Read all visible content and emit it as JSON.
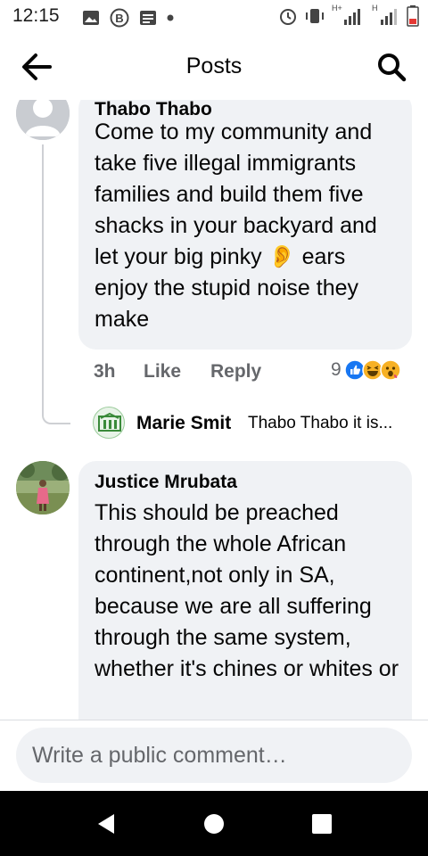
{
  "status_bar": {
    "time": "12:15",
    "icons_left": [
      "gallery-icon",
      "b-badge-icon",
      "news-icon",
      "dot-icon"
    ],
    "icons_right": [
      "alarm-icon",
      "vibrate-icon",
      "signal-h-plus-icon",
      "signal-h-icon",
      "battery-low-icon"
    ],
    "network_label_1": "H+",
    "network_label_2": "H"
  },
  "header": {
    "title": "Posts",
    "back_icon": "arrow-left-icon",
    "search_icon": "search-icon"
  },
  "comments": [
    {
      "author": "Thabo Thabo",
      "text": "Come to my community and take five illegal immigrants families and build them five shacks in your backyard and let your big pinky 👂 ears enjoy the stupid noise they make",
      "time": "3h",
      "like_label": "Like",
      "reply_label": "Reply",
      "reaction_count": "9",
      "reactions": [
        "like",
        "haha",
        "wow"
      ]
    },
    {
      "author": "Marie Smit",
      "preview": "Thabo Thabo it is..."
    },
    {
      "author": "Justice Mrubata",
      "text": "This should be preached through the whole African continent,not only in SA, because we are all suffering through the same system, whether it's chines or whites or"
    }
  ],
  "composer": {
    "placeholder": "Write a public comment…"
  },
  "colors": {
    "bubble": "#f0f2f5",
    "meta_text": "#65676b",
    "like_blue": "#1877f2"
  }
}
